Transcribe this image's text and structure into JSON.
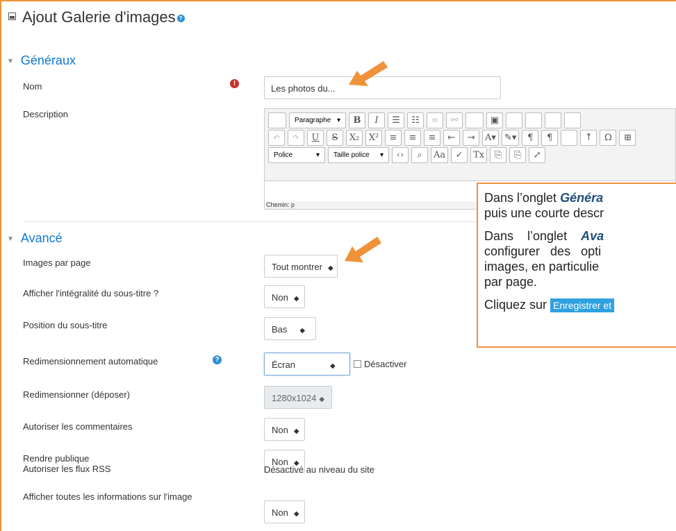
{
  "page": {
    "title": "Ajout Galerie d'images",
    "help_glyph": "?"
  },
  "sections": {
    "general": "Généraux",
    "advanced": "Avancé"
  },
  "fields": {
    "name": {
      "label": "Nom",
      "value": "Les photos du...",
      "required_glyph": "!"
    },
    "description": {
      "label": "Description"
    },
    "images_per_page": {
      "label": "Images par page",
      "value": "Tout montrer"
    },
    "full_caption": {
      "label": "Afficher l'intégralité du sous-titre ?",
      "value": "Non"
    },
    "caption_position": {
      "label": "Position du sous-titre",
      "value": "Bas"
    },
    "auto_resize": {
      "label": "Redimensionnement automatique",
      "value": "Écran",
      "help_glyph": "?",
      "disable_label": "Désactiver"
    },
    "resize_upload": {
      "label": "Redimensionner (déposer)",
      "value": "1280x1024"
    },
    "allow_comments": {
      "label": "Autoriser les commentaires",
      "value": "Non"
    },
    "make_public": {
      "label": "Rendre publique",
      "value": "Non"
    },
    "rss": {
      "label": "Autoriser les flux RSS",
      "value": "Désactivé au niveau du site"
    },
    "show_all_info": {
      "label": "Afficher toutes les informations sur l'image",
      "value": "Non"
    }
  },
  "editor": {
    "format_select": "Paragraphe",
    "font_select": "Police",
    "size_select": "Taille police",
    "path": "Chemin: p"
  },
  "tip": {
    "l1_pre": "Dans l’onglet ",
    "l1_em": "Généra",
    "l2": "puis une courte descr",
    "l3_pre": "Dans    l’onglet    ",
    "l3_em": "Ava",
    "l4": "configurer   des   opti",
    "l5": "images, en particulie",
    "l6": "par page.",
    "l7_pre": "Cliquez sur ",
    "l7_badge": "Enregistrer et"
  },
  "colors": {
    "accent": "#1177d1",
    "callout": "#f0923a",
    "required": "#c9302c",
    "button": "#2ea1df"
  }
}
